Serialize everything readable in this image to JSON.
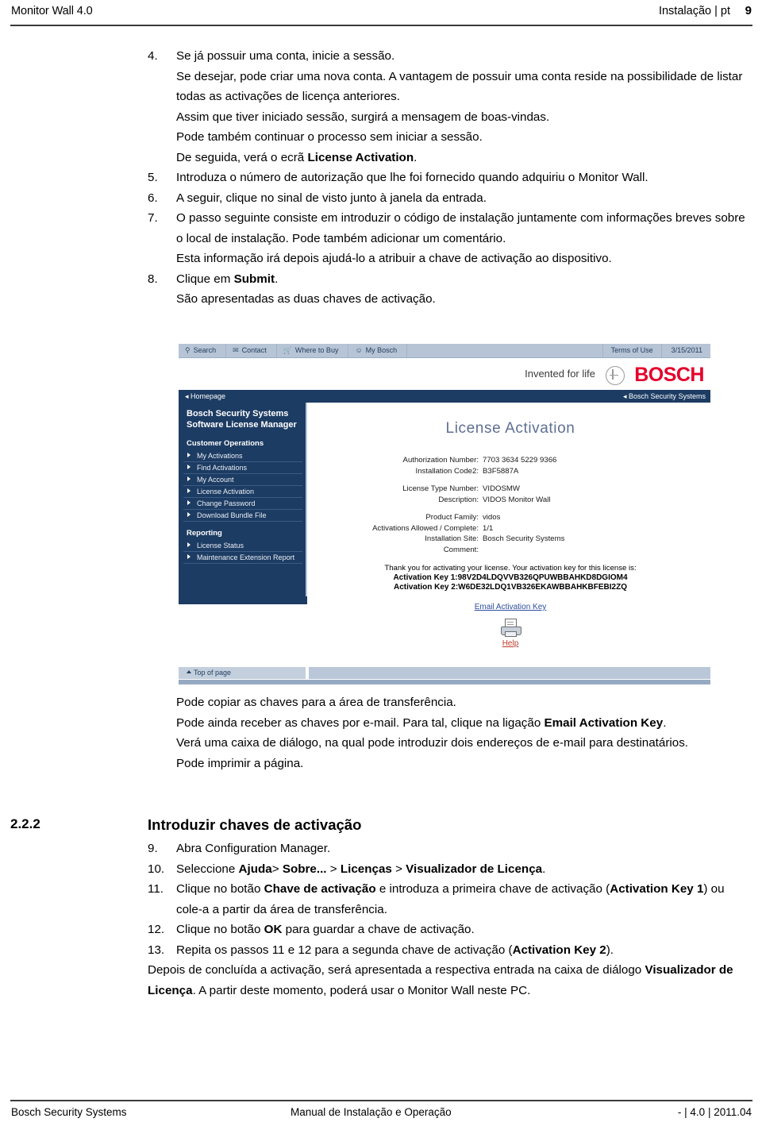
{
  "header": {
    "left": "Monitor Wall 4.0",
    "right": "Instalação | pt",
    "page_number": "9"
  },
  "steps": [
    {
      "number": "4.",
      "lines": [
        "Se já possuir uma conta, inicie a sessão.",
        "Se desejar, pode criar uma nova conta. A vantagem de possuir uma conta reside na possibilidade de listar todas as activações de licença anteriores.",
        "Assim que tiver iniciado sessão, surgirá a mensagem de boas-vindas.",
        "Pode também continuar o processo sem iniciar a sessão.",
        "De seguida, verá o ecrã License Activation."
      ]
    },
    {
      "number": "5.",
      "lines": [
        "Introduza o número de autorização que lhe foi fornecido quando adquiriu o Monitor Wall."
      ]
    },
    {
      "number": "6.",
      "lines": [
        "A seguir, clique no sinal de visto junto à janela da entrada."
      ]
    },
    {
      "number": "7.",
      "lines": [
        "O passo seguinte consiste em introduzir o código de instalação juntamente com informações breves sobre o local de instalação. Pode também adicionar um comentário.",
        "Esta informação irá depois ajudá-lo a atribuir a chave de activação ao dispositivo."
      ]
    },
    {
      "number": "8.",
      "lines": [
        "Clique em Submit.",
        "São apresentadas as duas chaves de activação."
      ]
    }
  ],
  "step4_line1": "Se já possuir uma conta, inicie a sessão.",
  "step4_line2": "Se desejar, pode criar uma nova conta. A vantagem de possuir uma conta reside na possibilidade de listar todas as activações de licença anteriores.",
  "step4_line3": "Assim que tiver iniciado sessão, surgirá a mensagem de boas-vindas.",
  "step4_line4": "Pode também continuar o processo sem iniciar a sessão.",
  "step4_line5_pre": "De seguida, verá o ecrã ",
  "step4_line5_bold": "License Activation",
  "step4_line5_post": ".",
  "step5_text": "Introduza o número de autorização que lhe foi fornecido quando adquiriu o Monitor Wall.",
  "step6_text": "A seguir, clique no sinal de visto junto à janela da entrada.",
  "step7_line1": "O passo seguinte consiste em introduzir o código de instalação juntamente com informações breves sobre o local de instalação. Pode também adicionar um comentário.",
  "step7_line2": "Esta informação irá depois ajudá-lo a atribuir a chave de activação ao dispositivo.",
  "step8_line1_pre": "Clique em ",
  "step8_line1_bold": "Submit",
  "step8_line1_post": ".",
  "step8_line2": "São apresentadas as duas chaves de activação.",
  "screenshot": {
    "toolbar": {
      "items": [
        {
          "icon": "search-icon",
          "glyph": "⌕",
          "label": "Search"
        },
        {
          "icon": "envelope-icon",
          "glyph": "✉",
          "label": "Contact"
        },
        {
          "icon": "cart-icon",
          "glyph": "Ὥ2",
          "label": "Where to Buy"
        },
        {
          "icon": "smiley-icon",
          "glyph": "☺",
          "label": "My Bosch"
        }
      ],
      "terms": "Terms of Use",
      "date": "3/15/2011"
    },
    "brand": {
      "slogan": "Invented for life",
      "name": "BOSCH"
    },
    "navbar": {
      "left": "Homepage",
      "right": "Bosch Security Systems"
    },
    "sidebar": {
      "title": "Bosch Security Systems Software License Manager",
      "groups": [
        {
          "label": "Customer Operations",
          "items": [
            "My Activations",
            "Find Activations",
            "My Account",
            "License Activation",
            "Change Password",
            "Download Bundle File"
          ]
        },
        {
          "label": "Reporting",
          "items": [
            "License Status",
            "Maintenance Extension Report"
          ]
        }
      ]
    },
    "panel": {
      "title": "License Activation",
      "fields": [
        {
          "label": "Authorization Number:",
          "value": "7703 3634 5229 9366"
        },
        {
          "label": "Installation Code2:",
          "value": "B3F5887A"
        },
        {
          "label": "License Type Number:",
          "value": "VIDOSMW"
        },
        {
          "label": "Description:",
          "value": "VIDOS Monitor Wall"
        },
        {
          "label": "Product Family:",
          "value": "vidos"
        },
        {
          "label": "Activations Allowed / Complete:",
          "value": "1/1"
        },
        {
          "label": "Installation Site:",
          "value": "Bosch Security Systems"
        },
        {
          "label": "Comment:",
          "value": ""
        }
      ],
      "thanks": "Thank you for activating your license. Your activation key for this license is:",
      "activation_key_1": "Activation Key 1:98V2D4LDQVVB326QPUWBBAHKD8DGIOM4",
      "activation_key_2": "Activation Key 2:W6DE32LDQ1VB326EKAWBBAHKBFEBI2ZQ",
      "email_link": "Email Activation Key",
      "help_link": "Help"
    },
    "bottom": {
      "top_of_page": "Top of page"
    }
  },
  "after_image": {
    "line1": "Pode copiar as chaves para a área de transferência.",
    "line2_pre": "Pode ainda receber as chaves por e-mail. Para tal, clique na ligação ",
    "line2_bold": "Email Activation Key",
    "line2_post": ".",
    "line3": "Verá uma caixa de diálogo, na qual pode introduzir dois endereços de e-mail para destinatários.",
    "line4": "Pode imprimir a página."
  },
  "section": {
    "number": "2.2.2",
    "title": "Introduzir chaves de activação",
    "step9_num": "9.",
    "step9_text": "Abra Configuration Manager.",
    "step10_num": "10.",
    "step10_pre": "Seleccione ",
    "step10_b1": "Ajuda",
    "step10_mid1": "> ",
    "step10_b2": "Sobre...",
    "step10_mid2": " > ",
    "step10_b3": "Licenças",
    "step10_mid3": " > ",
    "step10_b4": "Visualizador de Licença",
    "step10_post": ".",
    "step11_num": "11.",
    "step11_pre": "Clique no botão ",
    "step11_b1": "Chave de activação",
    "step11_mid": " e introduza a primeira chave de activação (",
    "step11_b2": "Activation Key 1",
    "step11_post": ") ou cole-a a partir da área de transferência.",
    "step12_num": "12.",
    "step12_pre": "Clique no botão ",
    "step12_b1": "OK",
    "step12_post": " para guardar a chave de activação.",
    "step13_num": "13.",
    "step13_pre": "Repita os passos 11 e 12 para a segunda chave de activação (",
    "step13_b1": "Activation Key 2",
    "step13_post": ").",
    "closing_pre": "Depois de concluída a activação, será apresentada a respectiva entrada na caixa de diálogo ",
    "closing_bold": "Visualizador de Licença",
    "closing_post": ". A partir deste momento, poderá usar o Monitor Wall neste PC."
  },
  "footer": {
    "left": "Bosch Security Systems",
    "middle": "Manual de Instalação e Operação",
    "right": "- | 4.0 | 2011.04"
  }
}
